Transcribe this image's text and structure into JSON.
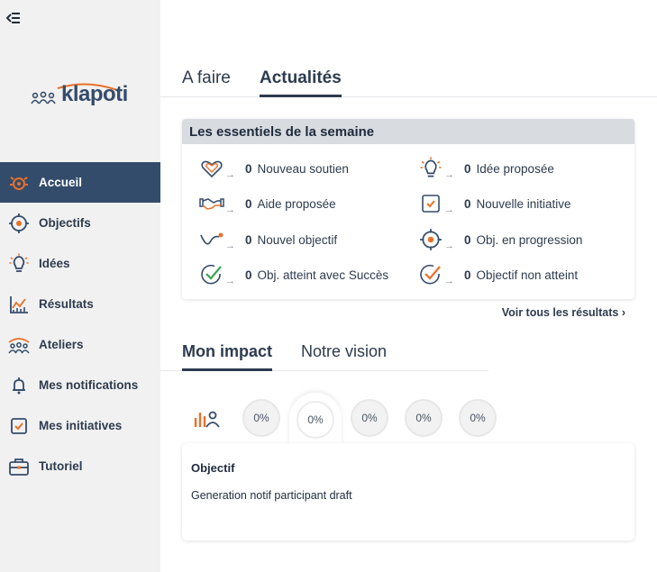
{
  "brand": {
    "name": "klapoti"
  },
  "sidebar": {
    "items": [
      {
        "label": "Accueil",
        "icon": "target-burst-icon",
        "active": true
      },
      {
        "label": "Objectifs",
        "icon": "target-icon"
      },
      {
        "label": "Idées",
        "icon": "lightbulb-icon"
      },
      {
        "label": "Résultats",
        "icon": "chart-icon"
      },
      {
        "label": "Ateliers",
        "icon": "people-icon"
      },
      {
        "label": "Mes notifications",
        "icon": "bell-icon"
      },
      {
        "label": "Mes initiatives",
        "icon": "checkbox-icon"
      },
      {
        "label": "Tutoriel",
        "icon": "briefcase-icon"
      }
    ]
  },
  "main_tabs": [
    {
      "label": "A faire",
      "active": false
    },
    {
      "label": "Actualités",
      "active": true
    }
  ],
  "week": {
    "title": "Les essentiels de la semaine",
    "stats": [
      {
        "count": "0",
        "label": "Nouveau soutien",
        "icon": "heart-hands-icon"
      },
      {
        "count": "0",
        "label": "Idée proposée",
        "icon": "lightbulb-icon"
      },
      {
        "count": "0",
        "label": "Aide proposée",
        "icon": "handshake-icon"
      },
      {
        "count": "0",
        "label": "Nouvelle initiative",
        "icon": "checkbox-icon"
      },
      {
        "count": "0",
        "label": "Nouvel objectif",
        "icon": "new-goal-icon"
      },
      {
        "count": "0",
        "label": "Obj. en progression",
        "icon": "target-icon"
      },
      {
        "count": "0",
        "label": "Obj. atteint avec Succès",
        "icon": "success-check-icon"
      },
      {
        "count": "0",
        "label": "Objectif non atteint",
        "icon": "unmet-check-icon"
      }
    ],
    "arrow": "→"
  },
  "see_all": "Voir tous les résultats ›",
  "impact_tabs": [
    {
      "label": "Mon impact",
      "active": true
    },
    {
      "label": "Notre vision",
      "active": false
    }
  ],
  "impact_circles": [
    "0%",
    "0%",
    "0%",
    "0%",
    "0%"
  ],
  "objective": {
    "title": "Objectif",
    "description": "Generation notif participant draft"
  },
  "colors": {
    "navy": "#344c6b",
    "orange": "#e8702a",
    "text": "#2d3b4e"
  }
}
